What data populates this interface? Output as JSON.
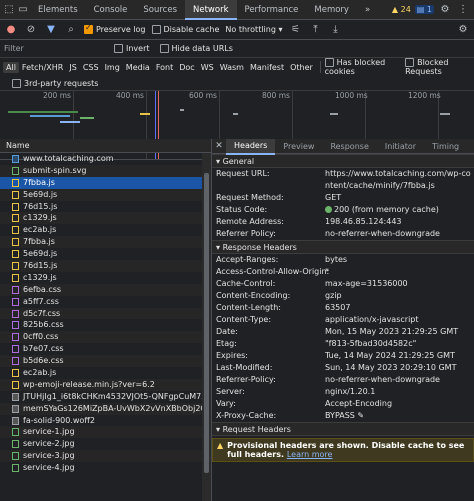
{
  "tabs": [
    "Elements",
    "Console",
    "Sources",
    "Network",
    "Performance",
    "Memory"
  ],
  "badges": {
    "warnings": "24",
    "messages": "1"
  },
  "toolbar": {
    "preserve_log": "Preserve log",
    "disable_cache": "Disable cache",
    "throttle": "No throttling"
  },
  "filter": {
    "placeholder": "Filter",
    "invert": "Invert",
    "hide_data_urls": "Hide data URLs"
  },
  "types": [
    "All",
    "Fetch/XHR",
    "JS",
    "CSS",
    "Img",
    "Media",
    "Font",
    "Doc",
    "WS",
    "Wasm",
    "Manifest",
    "Other"
  ],
  "type_checks": {
    "blocked_cookies": "Has blocked cookies",
    "blocked_requests": "Blocked Requests",
    "third_party": "3rd-party requests"
  },
  "timeline": {
    "ticks": [
      "200 ms",
      "400 ms",
      "600 ms",
      "800 ms",
      "1000 ms",
      "1200 ms"
    ]
  },
  "request_list": {
    "header": "Name",
    "items": [
      {
        "name": "www.totalcaching.com",
        "type": "doc"
      },
      {
        "name": "submit-spin.svg",
        "type": "img"
      },
      {
        "name": "7fbba.js",
        "type": "js"
      },
      {
        "name": "5e69d.js",
        "type": "js"
      },
      {
        "name": "76d15.js",
        "type": "js"
      },
      {
        "name": "c1329.js",
        "type": "js"
      },
      {
        "name": "ec2ab.js",
        "type": "js"
      },
      {
        "name": "7fbba.js",
        "type": "js"
      },
      {
        "name": "5e69d.js",
        "type": "js"
      },
      {
        "name": "76d15.js",
        "type": "js"
      },
      {
        "name": "c1329.js",
        "type": "js"
      },
      {
        "name": "6efba.css",
        "type": "css"
      },
      {
        "name": "a5ff7.css",
        "type": "css"
      },
      {
        "name": "d5c7f.css",
        "type": "css"
      },
      {
        "name": "825b6.css",
        "type": "css"
      },
      {
        "name": "0cff0.css",
        "type": "css"
      },
      {
        "name": "b7e07.css",
        "type": "css"
      },
      {
        "name": "b5d6e.css",
        "type": "css"
      },
      {
        "name": "ec2ab.js",
        "type": "js"
      },
      {
        "name": "wp-emoji-release.min.js?ver=6.2",
        "type": "js"
      },
      {
        "name": "JTUHjIg1_i6t8kCHKm4532VJOt5-QNFgpCuM73w5aX",
        "type": "font"
      },
      {
        "name": "memSYaGs126MiZpBA-UvWbX2vVnXBbObj2OVZyO",
        "type": "font"
      },
      {
        "name": "fa-solid-900.woff2",
        "type": "font"
      },
      {
        "name": "service-1.jpg",
        "type": "img"
      },
      {
        "name": "service-2.jpg",
        "type": "img"
      },
      {
        "name": "service-3.jpg",
        "type": "img"
      },
      {
        "name": "service-4.jpg",
        "type": "img"
      }
    ]
  },
  "details": {
    "tabs": [
      "Headers",
      "Preview",
      "Response",
      "Initiator",
      "Timing"
    ],
    "general_title": "General",
    "general": [
      {
        "k": "Request URL:",
        "v": "https://www.totalcaching.com/wp-content/cache/minify/7fbba.js"
      },
      {
        "k": "Request Method:",
        "v": "GET"
      },
      {
        "k": "Status Code:",
        "v": "200 (from memory cache)"
      },
      {
        "k": "Remote Address:",
        "v": "198.46.85.124:443"
      },
      {
        "k": "Referrer Policy:",
        "v": "no-referrer-when-downgrade"
      }
    ],
    "response_title": "Response Headers",
    "response": [
      {
        "k": "Accept-Ranges:",
        "v": "bytes"
      },
      {
        "k": "Access-Control-Allow-Origin:",
        "v": "*"
      },
      {
        "k": "Cache-Control:",
        "v": "max-age=31536000"
      },
      {
        "k": "Content-Encoding:",
        "v": "gzip"
      },
      {
        "k": "Content-Length:",
        "v": "63507"
      },
      {
        "k": "Content-Type:",
        "v": "application/x-javascript"
      },
      {
        "k": "Date:",
        "v": "Mon, 15 May 2023 21:29:25 GMT"
      },
      {
        "k": "Etag:",
        "v": "\"f813-5fbad30d4582c\""
      },
      {
        "k": "Expires:",
        "v": "Tue, 14 May 2024 21:29:25 GMT"
      },
      {
        "k": "Last-Modified:",
        "v": "Sun, 14 May 2023 20:29:10 GMT"
      },
      {
        "k": "Referrer-Policy:",
        "v": "no-referrer-when-downgrade"
      },
      {
        "k": "Server:",
        "v": "nginx/1.20.1"
      },
      {
        "k": "Vary:",
        "v": "Accept-Encoding"
      },
      {
        "k": "X-Proxy-Cache:",
        "v": "BYPASS"
      }
    ],
    "request_title": "Request Headers",
    "warning": "Provisional headers are shown. Disable cache to see full headers.",
    "learn_more": "Learn more"
  }
}
